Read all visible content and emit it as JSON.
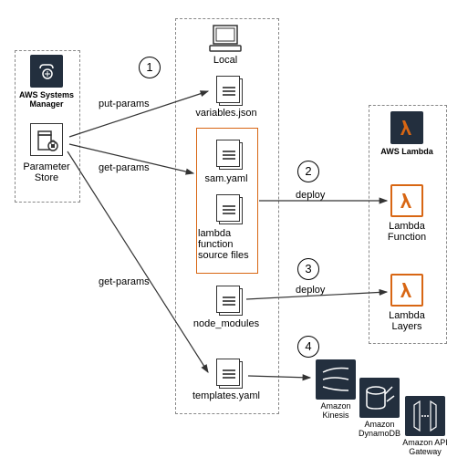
{
  "left_panel": {
    "systems_manager": "AWS Systems\nManager",
    "parameter_store": "Parameter\nStore"
  },
  "center_panel": {
    "local": "Local",
    "variables": "variables.json",
    "sam": "sam.yaml",
    "lambda_src": "lambda\nfunction\nsource files",
    "node_modules": "node_modules",
    "templates": "templates.yaml"
  },
  "right_panel": {
    "aws_lambda": "AWS Lambda",
    "lambda_function": "Lambda\nFunction",
    "lambda_layers": "Lambda\nLayers"
  },
  "bottom_services": {
    "kinesis": "Amazon\nKinesis",
    "dynamodb": "Amazon\nDynamoDB",
    "apigw": "Amazon API\nGateway"
  },
  "edges": {
    "put_params": "put-params",
    "get_params1": "get-params",
    "get_params2": "get-params",
    "deploy1": "deploy",
    "deploy2": "deploy"
  },
  "steps": {
    "s1": "1",
    "s2": "2",
    "s3": "3",
    "s4": "4"
  },
  "chart_data": {
    "type": "diagram",
    "title": "AWS SAM deployment workflow",
    "nodes": [
      {
        "id": "systems_manager",
        "label": "AWS Systems Manager",
        "group": "left"
      },
      {
        "id": "parameter_store",
        "label": "Parameter Store",
        "group": "left"
      },
      {
        "id": "local",
        "label": "Local",
        "group": "center"
      },
      {
        "id": "variables_json",
        "label": "variables.json",
        "group": "center"
      },
      {
        "id": "sam_yaml",
        "label": "sam.yaml",
        "group": "center-source"
      },
      {
        "id": "lambda_source",
        "label": "lambda function source files",
        "group": "center-source"
      },
      {
        "id": "node_modules",
        "label": "node_modules",
        "group": "center"
      },
      {
        "id": "templates_yaml",
        "label": "templates.yaml",
        "group": "center"
      },
      {
        "id": "aws_lambda",
        "label": "AWS Lambda",
        "group": "right"
      },
      {
        "id": "lambda_function",
        "label": "Lambda Function",
        "group": "right"
      },
      {
        "id": "lambda_layers",
        "label": "Lambda Layers",
        "group": "right"
      },
      {
        "id": "kinesis",
        "label": "Amazon Kinesis",
        "group": "bottom"
      },
      {
        "id": "dynamodb",
        "label": "Amazon DynamoDB",
        "group": "bottom"
      },
      {
        "id": "api_gateway",
        "label": "Amazon API Gateway",
        "group": "bottom"
      }
    ],
    "edges": [
      {
        "from": "parameter_store",
        "to": "variables_json",
        "label": "put-params",
        "step": 1
      },
      {
        "from": "parameter_store",
        "to": "sam_yaml",
        "label": "get-params"
      },
      {
        "from": "parameter_store",
        "to": "templates_yaml",
        "label": "get-params"
      },
      {
        "from": "sam_yaml",
        "to": "lambda_function",
        "label": "deploy",
        "step": 2
      },
      {
        "from": "node_modules",
        "to": "lambda_layers",
        "label": "deploy",
        "step": 3
      },
      {
        "from": "templates_yaml",
        "to": "kinesis",
        "step": 4
      },
      {
        "from": "templates_yaml",
        "to": "dynamodb",
        "step": 4
      },
      {
        "from": "templates_yaml",
        "to": "api_gateway",
        "step": 4
      }
    ]
  }
}
